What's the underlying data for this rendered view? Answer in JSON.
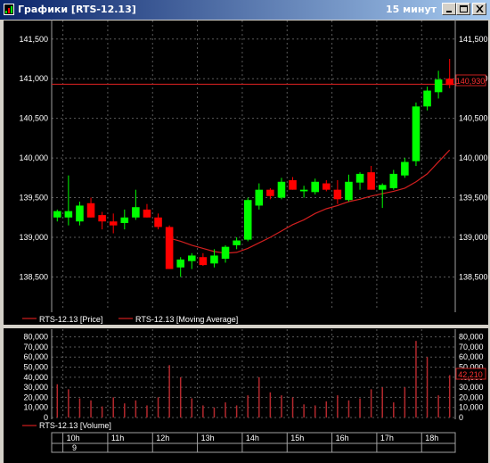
{
  "window": {
    "title": "Графики [RTS-12.13]",
    "interval": "15 минут"
  },
  "colors": {
    "background": "#000000",
    "grid": "#5a5a5a",
    "bull": "#00ff00",
    "bear": "#ff0000",
    "ma": "#d21f1f",
    "axis_text": "#ffffff",
    "price_line": "#c81e1e",
    "volume_bar": "#b4282d"
  },
  "price_panel": {
    "legend": [
      "RTS-12.13 [Price]",
      "RTS-12.13 [Moving Average]"
    ],
    "current_price_label": "140,930",
    "y_ticks": [
      "141,500",
      "141,000",
      "140,500",
      "140,000",
      "139,500",
      "139,000",
      "138,500"
    ]
  },
  "volume_panel": {
    "legend": "RTS-12.13 [Volume]",
    "current_volume_label": "42,210",
    "y_ticks": [
      "80,000",
      "70,000",
      "60,000",
      "50,000",
      "40,000",
      "30,000",
      "20,000",
      "10,000",
      "0"
    ]
  },
  "time_axis": {
    "labels": [
      "10h",
      "11h",
      "12h",
      "13h",
      "14h",
      "15h",
      "16h",
      "17h",
      "18h"
    ],
    "date_label": "9"
  },
  "chart_data": [
    {
      "type": "candlestick",
      "title": "",
      "ylim": [
        138100,
        141700
      ],
      "current_price": 140930,
      "series": [
        {
          "name": "RTS-12.13 [Price]",
          "candles": [
            {
              "o": 139250,
              "h": 139350,
              "l": 139200,
              "c": 139330
            },
            {
              "o": 139250,
              "h": 139780,
              "l": 139150,
              "c": 139330
            },
            {
              "o": 139200,
              "h": 139450,
              "l": 139150,
              "c": 139400
            },
            {
              "o": 139430,
              "h": 139500,
              "l": 139250,
              "c": 139250
            },
            {
              "o": 139280,
              "h": 139320,
              "l": 139100,
              "c": 139200
            },
            {
              "o": 139200,
              "h": 139300,
              "l": 139050,
              "c": 139150
            },
            {
              "o": 139180,
              "h": 139350,
              "l": 139100,
              "c": 139250
            },
            {
              "o": 139250,
              "h": 139600,
              "l": 139220,
              "c": 139380
            },
            {
              "o": 139350,
              "h": 139420,
              "l": 139250,
              "c": 139250
            },
            {
              "o": 139250,
              "h": 139300,
              "l": 139100,
              "c": 139130
            },
            {
              "o": 139130,
              "h": 139150,
              "l": 138600,
              "c": 138600
            },
            {
              "o": 138620,
              "h": 138750,
              "l": 138500,
              "c": 138720
            },
            {
              "o": 138700,
              "h": 138800,
              "l": 138600,
              "c": 138770
            },
            {
              "o": 138750,
              "h": 138800,
              "l": 138640,
              "c": 138650
            },
            {
              "o": 138670,
              "h": 138850,
              "l": 138620,
              "c": 138770
            },
            {
              "o": 138730,
              "h": 138900,
              "l": 138680,
              "c": 138880
            },
            {
              "o": 138900,
              "h": 139000,
              "l": 138850,
              "c": 138960
            },
            {
              "o": 138970,
              "h": 139500,
              "l": 138950,
              "c": 139470
            },
            {
              "o": 139400,
              "h": 139680,
              "l": 139350,
              "c": 139600
            },
            {
              "o": 139600,
              "h": 139620,
              "l": 139480,
              "c": 139520
            },
            {
              "o": 139500,
              "h": 139750,
              "l": 139480,
              "c": 139700
            },
            {
              "o": 139720,
              "h": 139760,
              "l": 139600,
              "c": 139600
            },
            {
              "o": 139580,
              "h": 139650,
              "l": 139500,
              "c": 139600
            },
            {
              "o": 139570,
              "h": 139740,
              "l": 139540,
              "c": 139700
            },
            {
              "o": 139680,
              "h": 139720,
              "l": 139580,
              "c": 139600
            },
            {
              "o": 139600,
              "h": 139720,
              "l": 139420,
              "c": 139480
            },
            {
              "o": 139470,
              "h": 139790,
              "l": 139450,
              "c": 139700
            },
            {
              "o": 139690,
              "h": 139820,
              "l": 139600,
              "c": 139800
            },
            {
              "o": 139820,
              "h": 139900,
              "l": 139600,
              "c": 139600
            },
            {
              "o": 139600,
              "h": 139680,
              "l": 139370,
              "c": 139660
            },
            {
              "o": 139620,
              "h": 139850,
              "l": 139600,
              "c": 139800
            },
            {
              "o": 139780,
              "h": 140000,
              "l": 139750,
              "c": 139950
            },
            {
              "o": 139960,
              "h": 140700,
              "l": 139900,
              "c": 140650
            },
            {
              "o": 140650,
              "h": 140900,
              "l": 140600,
              "c": 140850
            },
            {
              "o": 140830,
              "h": 141100,
              "l": 140750,
              "c": 140990
            },
            {
              "o": 141000,
              "h": 141250,
              "l": 140880,
              "c": 140920
            }
          ]
        },
        {
          "name": "RTS-12.13 [Moving Average]",
          "values": [
            null,
            null,
            null,
            null,
            null,
            null,
            null,
            null,
            null,
            null,
            138990,
            138950,
            138900,
            138860,
            138820,
            138800,
            138810,
            138860,
            138930,
            139000,
            139080,
            139160,
            139220,
            139300,
            139360,
            139400,
            139450,
            139480,
            139520,
            139550,
            139580,
            139620,
            139700,
            139800,
            139950,
            140100
          ]
        }
      ]
    },
    {
      "type": "bar",
      "title": "",
      "ylim": [
        0,
        85000
      ],
      "current_volume": 42210,
      "series": [
        {
          "name": "RTS-12.13 [Volume]",
          "values": [
            33000,
            28000,
            19000,
            17000,
            11000,
            20000,
            14000,
            17000,
            12000,
            20000,
            52000,
            40000,
            19000,
            12000,
            10000,
            15000,
            12000,
            22000,
            40000,
            25000,
            22000,
            20000,
            13000,
            12000,
            16000,
            22000,
            17000,
            19000,
            28000,
            30000,
            15000,
            30000,
            76000,
            60000,
            22000,
            42000
          ]
        }
      ]
    }
  ]
}
